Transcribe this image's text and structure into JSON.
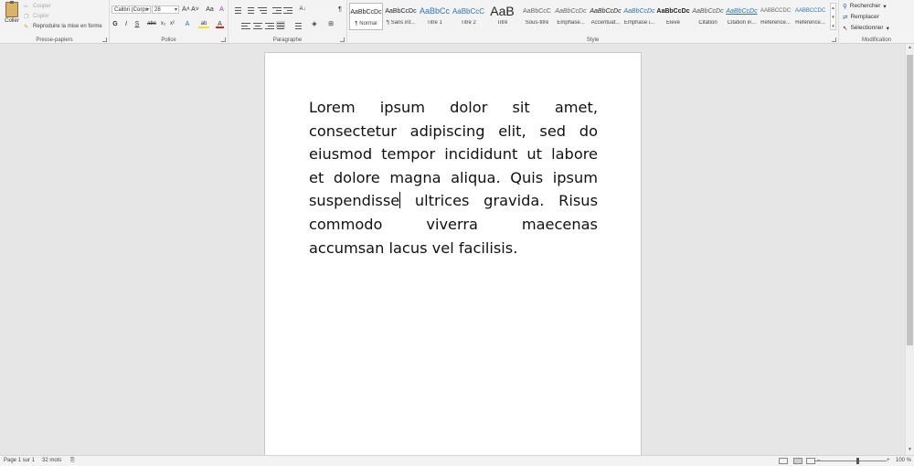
{
  "ribbon": {
    "clipboard": {
      "paste_label": "Coller",
      "cut_label": "Couper",
      "copy_label": "Copier",
      "format_painter_label": "Reproduire la mise en forme",
      "group_label": "Presse-papiers"
    },
    "font": {
      "font_name": "Calibri (Corps",
      "font_size": "28",
      "grow_label": "A˄",
      "shrink_label": "A˅",
      "case_label": "Aa",
      "clear_label": "A",
      "bold_label": "G",
      "italic_label": "I",
      "underline_label": "S",
      "strike_label": "abc",
      "subscript_label": "x₂",
      "superscript_label": "x²",
      "effects_label": "A",
      "highlight_label": "ab",
      "color_label": "A",
      "group_label": "Police"
    },
    "paragraph": {
      "show_marks_label": "¶",
      "group_label": "Paragraphe"
    },
    "styles": {
      "items": [
        {
          "sample": "AaBbCcDc",
          "name": "¶ Normal"
        },
        {
          "sample": "AaBbCcDc",
          "name": "¶ Sans int..."
        },
        {
          "sample": "AaBbCc",
          "name": "Titre 1"
        },
        {
          "sample": "AaBbCcC",
          "name": "Titre 2"
        },
        {
          "sample": "AaB",
          "name": "Titre"
        },
        {
          "sample": "AaBbCcC",
          "name": "Sous-titre"
        },
        {
          "sample": "AaBbCcDc",
          "name": "Emphase..."
        },
        {
          "sample": "AaBbCcDc",
          "name": "Accentuat..."
        },
        {
          "sample": "AaBbCcDc",
          "name": "Emphase i..."
        },
        {
          "sample": "AaBbCcDc",
          "name": "Élevé"
        },
        {
          "sample": "AaBbCcDc",
          "name": "Citation"
        },
        {
          "sample": "AaBbCcDc",
          "name": "Citation in..."
        },
        {
          "sample": "AABBCCDC",
          "name": "Référence..."
        },
        {
          "sample": "AABBCCDC",
          "name": "Référence..."
        }
      ],
      "group_label": "Style"
    },
    "editing": {
      "find_label": "Rechercher",
      "replace_label": "Remplacer",
      "select_label": "Sélectionner",
      "group_label": "Modification"
    }
  },
  "document": {
    "text_before_caret": "Lorem ipsum dolor sit amet, consectetur adipiscing elit, sed do eiusmod tempor incididunt ut labore et dolore magna aliqua. Quis ipsum suspendisse",
    "text_after_caret": " ultrices gravida. Risus commodo viverra maecenas accumsan lacus vel facilisis."
  },
  "status": {
    "page": "Page 1 sur 1",
    "words": "32 mots",
    "zoom_minus": "–",
    "zoom_plus": "+",
    "zoom_level": "100 %"
  },
  "colors": {
    "highlight": "#f5e12c",
    "font_color": "#d9261c",
    "accent": "#2b579a"
  }
}
